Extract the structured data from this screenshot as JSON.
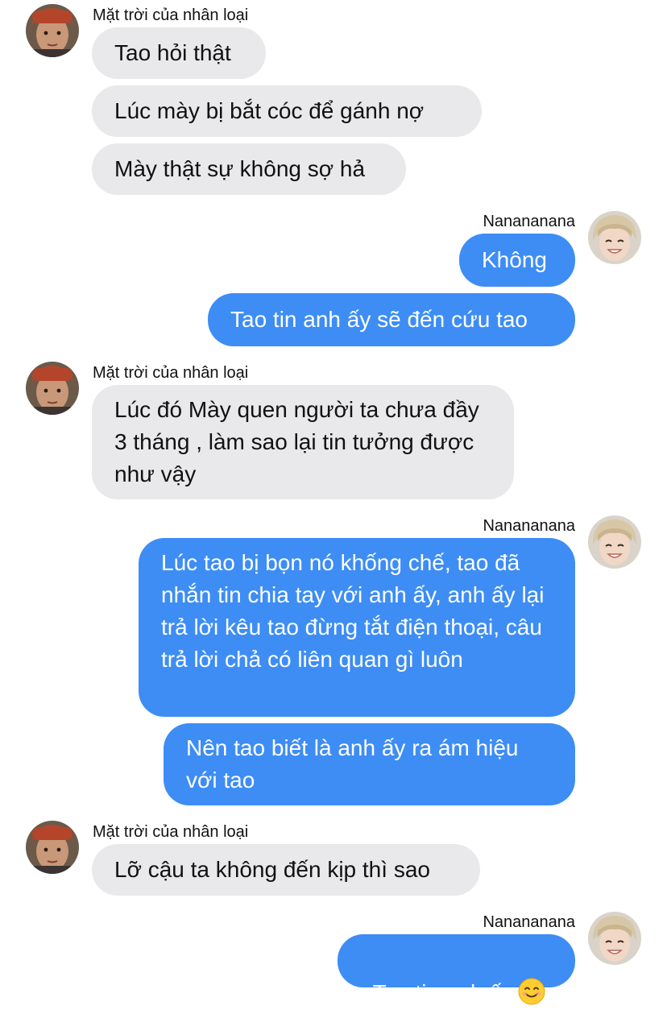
{
  "chat": {
    "other_name": "Mặt trời của nhân loại",
    "me_name": "Nanananana",
    "messages": [
      "Tao hỏi thật",
      "Lúc mày bị bắt cóc để gánh nợ",
      "Mày thật sự không sợ hả",
      "Không",
      "Tao tin anh ấy sẽ đến cứu tao",
      "Lúc đó Mày quen người ta chưa đầy 3 tháng , làm sao lại tin tưởng được như vậy",
      "Lúc tao bị bọn nó khống chế, tao đã nhắn tin chia tay với anh ấy, anh ấy lại trả lời kêu tao đừng tắt điện thoại, câu trả lời chả có liên quan gì luôn",
      "Nên tao biết là anh ấy ra ám hiệu với tao",
      "Lỡ cậu ta không đến kịp thì sao",
      "Tao tin anh ấy"
    ],
    "last_message_emoji": "smiling-face-emoji"
  },
  "colors": {
    "incoming_bubble": "#e9e9eb",
    "outgoing_bubble": "#3d8df5",
    "background": "#ffffff"
  }
}
